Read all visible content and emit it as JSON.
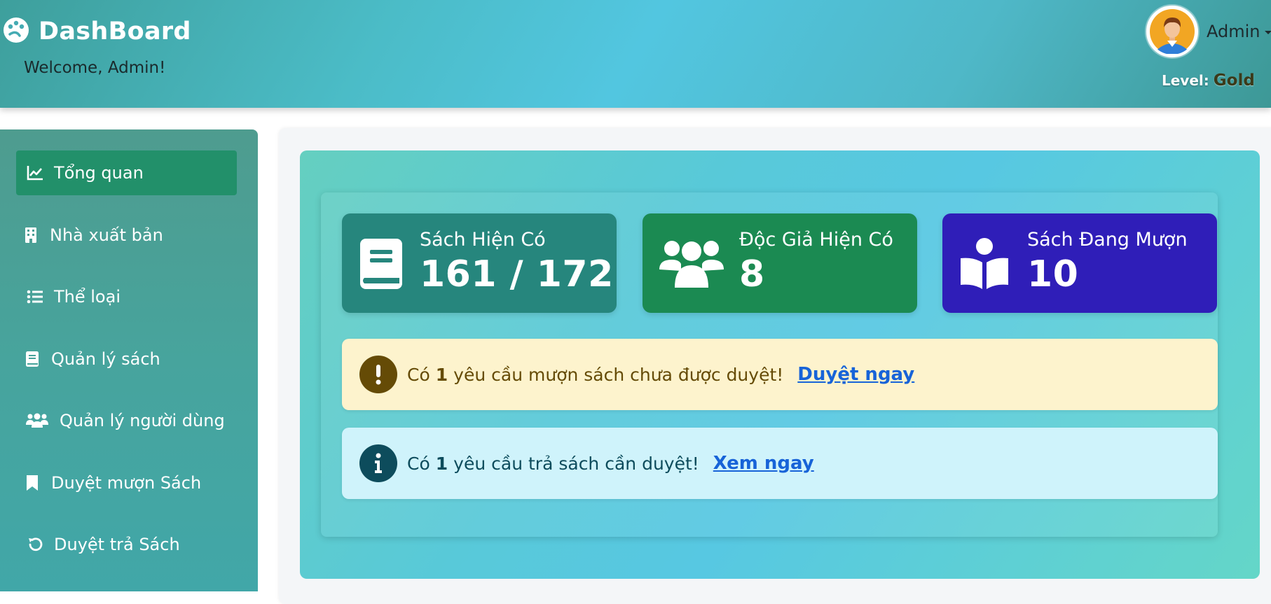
{
  "header": {
    "title": "DashBoard",
    "welcome": "Welcome, Admin!",
    "user_name": "Admin",
    "level_label": "Level:",
    "level_value": "Gold",
    "icons": {
      "brand": "palette-icon",
      "avatar": "user-avatar-icon",
      "dropdown": "caret-down-icon"
    }
  },
  "sidebar": {
    "items": [
      {
        "label": "Tổng quan",
        "icon": "chart-line-icon",
        "active": true
      },
      {
        "label": "Nhà xuất bản",
        "icon": "building-icon",
        "active": false
      },
      {
        "label": "Thể loại",
        "icon": "list-icon",
        "active": false
      },
      {
        "label": "Quản lý sách",
        "icon": "book-icon",
        "active": false
      },
      {
        "label": "Quản lý người dùng",
        "icon": "users-icon",
        "active": false
      },
      {
        "label": "Duyệt mượn Sách",
        "icon": "bookmark-icon",
        "active": false
      },
      {
        "label": "Duyệt trả Sách",
        "icon": "undo-icon",
        "active": false
      }
    ]
  },
  "stats": [
    {
      "label": "Sách Hiện Có",
      "value": "161 / 172",
      "icon": "book-icon",
      "color": "#26867d"
    },
    {
      "label": "Độc Giả Hiện Có",
      "value": "8",
      "icon": "users-icon",
      "color": "#1b8a52"
    },
    {
      "label": "Sách Đang Mượn",
      "value": "10",
      "icon": "book-reader-icon",
      "color": "#2f1eb8"
    }
  ],
  "alerts": [
    {
      "prefix": "Có",
      "count": "1",
      "text": "yêu cầu mượn sách chưa được duyệt!",
      "link": "Duyệt ngay",
      "icon": "exclamation-icon",
      "bg": "#fdf3cd",
      "text_color": "#654b06",
      "icon_bg": "#654b06"
    },
    {
      "prefix": "Có",
      "count": "1",
      "text": "yêu cầu trả sách cần duyệt!",
      "link": "Xem ngay",
      "icon": "info-icon",
      "bg": "#cff3fb",
      "text_color": "#0d4c5c",
      "icon_bg": "#0d4c5c"
    }
  ]
}
